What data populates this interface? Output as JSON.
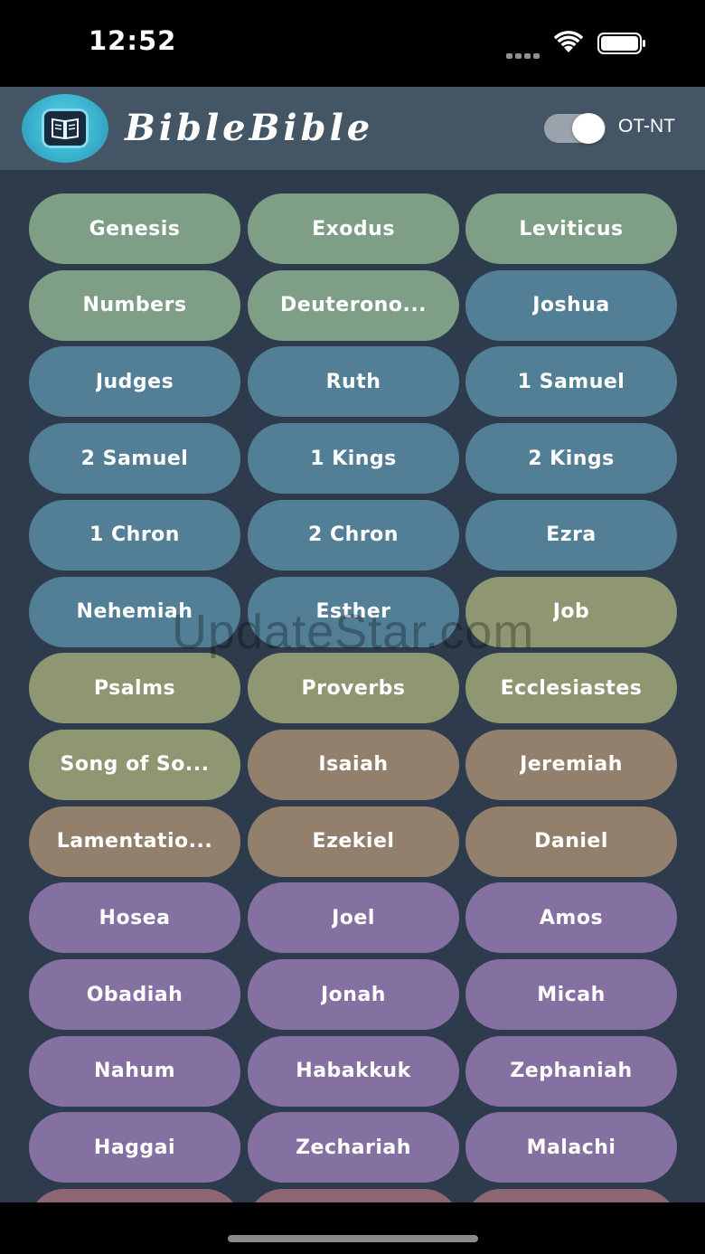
{
  "status_bar": {
    "time": "12:52"
  },
  "header": {
    "app_title": "BibleBible",
    "toggle_label": "OT-NT",
    "toggle_on": true
  },
  "colors": {
    "pentateuch": "#7f9e86",
    "history": "#537f96",
    "poetry": "#8f9772",
    "major_prophets": "#92806c",
    "minor_prophets": "#8471a2",
    "next_row": "#8e6672"
  },
  "books": [
    {
      "label": "Genesis",
      "group": "pentateuch"
    },
    {
      "label": "Exodus",
      "group": "pentateuch"
    },
    {
      "label": "Leviticus",
      "group": "pentateuch"
    },
    {
      "label": "Numbers",
      "group": "pentateuch"
    },
    {
      "label": "Deuterono...",
      "group": "pentateuch"
    },
    {
      "label": "Joshua",
      "group": "history"
    },
    {
      "label": "Judges",
      "group": "history"
    },
    {
      "label": "Ruth",
      "group": "history"
    },
    {
      "label": "1 Samuel",
      "group": "history"
    },
    {
      "label": "2 Samuel",
      "group": "history"
    },
    {
      "label": "1 Kings",
      "group": "history"
    },
    {
      "label": "2 Kings",
      "group": "history"
    },
    {
      "label": "1 Chron",
      "group": "history"
    },
    {
      "label": "2 Chron",
      "group": "history"
    },
    {
      "label": "Ezra",
      "group": "history"
    },
    {
      "label": "Nehemiah",
      "group": "history"
    },
    {
      "label": "Esther",
      "group": "history"
    },
    {
      "label": "Job",
      "group": "poetry"
    },
    {
      "label": "Psalms",
      "group": "poetry"
    },
    {
      "label": "Proverbs",
      "group": "poetry"
    },
    {
      "label": "Ecclesiastes",
      "group": "poetry"
    },
    {
      "label": "Song of So...",
      "group": "poetry"
    },
    {
      "label": "Isaiah",
      "group": "major_prophets"
    },
    {
      "label": "Jeremiah",
      "group": "major_prophets"
    },
    {
      "label": "Lamentatio...",
      "group": "major_prophets"
    },
    {
      "label": "Ezekiel",
      "group": "major_prophets"
    },
    {
      "label": "Daniel",
      "group": "major_prophets"
    },
    {
      "label": "Hosea",
      "group": "minor_prophets"
    },
    {
      "label": "Joel",
      "group": "minor_prophets"
    },
    {
      "label": "Amos",
      "group": "minor_prophets"
    },
    {
      "label": "Obadiah",
      "group": "minor_prophets"
    },
    {
      "label": "Jonah",
      "group": "minor_prophets"
    },
    {
      "label": "Micah",
      "group": "minor_prophets"
    },
    {
      "label": "Nahum",
      "group": "minor_prophets"
    },
    {
      "label": "Habakkuk",
      "group": "minor_prophets"
    },
    {
      "label": "Zephaniah",
      "group": "minor_prophets"
    },
    {
      "label": "Haggai",
      "group": "minor_prophets"
    },
    {
      "label": "Zechariah",
      "group": "minor_prophets"
    },
    {
      "label": "Malachi",
      "group": "minor_prophets"
    },
    {
      "label": "",
      "group": "next_row"
    },
    {
      "label": "",
      "group": "next_row"
    },
    {
      "label": "",
      "group": "next_row"
    }
  ],
  "watermark": "UpdateStar.com"
}
